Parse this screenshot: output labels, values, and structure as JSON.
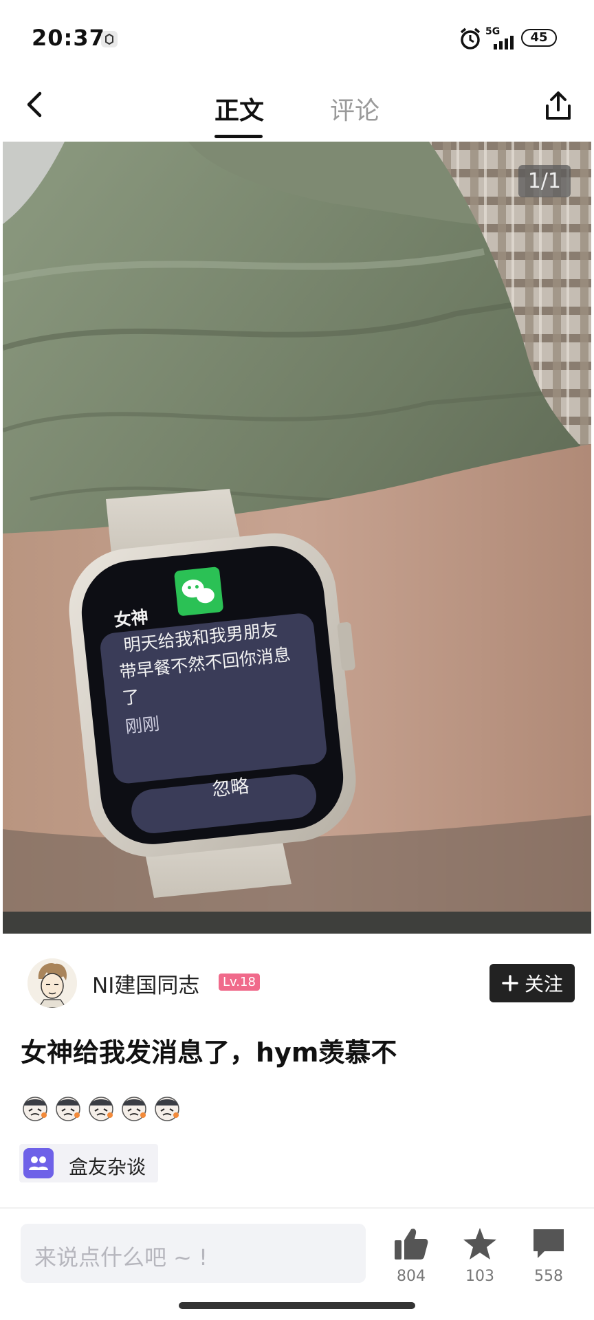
{
  "status_bar": {
    "time": "20:37",
    "icons": [
      "app-notification-icon",
      "alarm-icon",
      "5g-signal-icon"
    ],
    "network": "5G",
    "battery": "45"
  },
  "nav": {
    "back_icon": "chevron-left-icon",
    "tabs": [
      {
        "label": "正文",
        "active": true
      },
      {
        "label": "评论",
        "active": false
      }
    ],
    "share_icon": "share-icon"
  },
  "post_image": {
    "counter": "1/1",
    "watch": {
      "app_icon": "wechat-icon",
      "sender": "女神",
      "message_lines": [
        "明天给我和我男朋友",
        "带早餐不然不回你消息",
        "了"
      ],
      "time": "刚刚",
      "dismiss_label": "忽略"
    }
  },
  "author": {
    "name": "NI建国同志",
    "level": "Lv.18",
    "follow_label": "关注"
  },
  "post": {
    "title": "女神给我发消息了，hym羡慕不",
    "emoji_count": 5,
    "topic": "盒友杂谈"
  },
  "bottom_bar": {
    "placeholder": "来说点什么吧 ~ !",
    "like_count": "804",
    "star_count": "103",
    "comment_count": "558"
  },
  "colors": {
    "accent": "#6e61e8",
    "level_badge": "#f06a8b",
    "follow_bg": "#222222",
    "wechat_green": "#2bc155"
  }
}
